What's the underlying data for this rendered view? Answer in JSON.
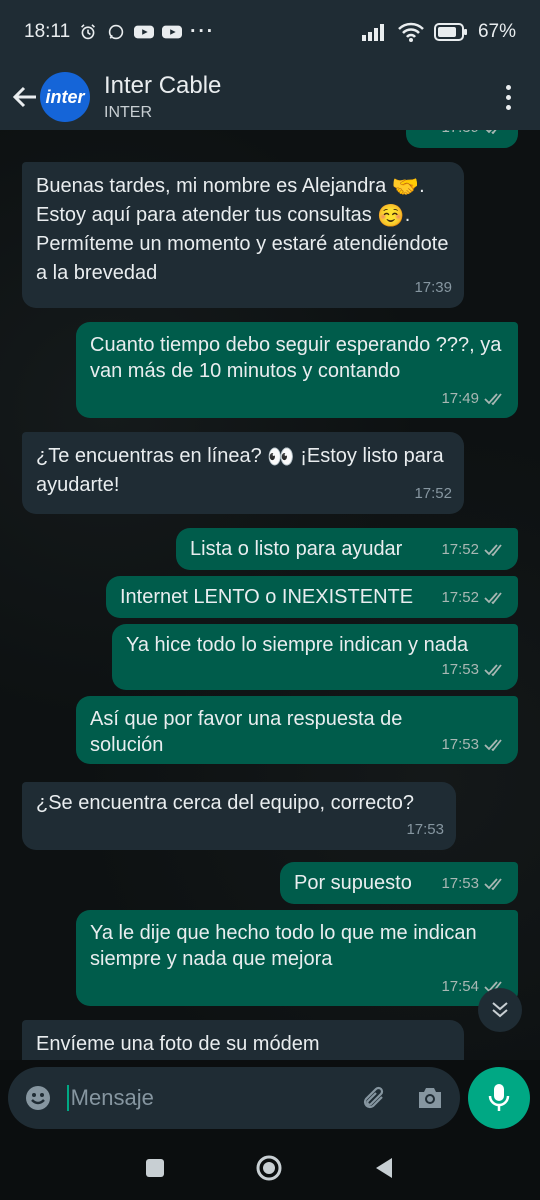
{
  "status_bar": {
    "time": "18:11",
    "battery": "67%",
    "notification_icons": [
      "alarm-icon",
      "whatsapp-icon",
      "youtube-icon",
      "youtube-icon"
    ],
    "more": "···"
  },
  "header": {
    "title": "Inter Cable",
    "subtitle": "INTER",
    "avatar_text": "inter",
    "avatar_color": "#1565d8"
  },
  "messages": [
    {
      "dir": "out",
      "text": "",
      "time": "17:39"
    },
    {
      "dir": "in",
      "text_parts": [
        "Buenas tardes, mi nombre es Alejandra ",
        "🤝",
        ".  Estoy aquí para atender tus consultas ",
        "☺️",
        ". Permíteme un momento y estaré atendiéndote a la brevedad"
      ],
      "time": "17:39"
    },
    {
      "dir": "out",
      "text": "Cuanto tiempo debo seguir esperando ???, ya van más de 10 minutos y contando",
      "time": "17:49"
    },
    {
      "dir": "in",
      "text_parts": [
        "¿Te encuentras en línea? ",
        "👀",
        " ¡Estoy listo para ayudarte!"
      ],
      "time": "17:52"
    },
    {
      "dir": "out",
      "text": "Lista o listo para ayudar",
      "time": "17:52"
    },
    {
      "dir": "out",
      "text": "Internet LENTO o INEXISTENTE",
      "time": "17:52"
    },
    {
      "dir": "out",
      "text": "Ya hice todo lo siempre indican y nada",
      "time": "17:53"
    },
    {
      "dir": "out",
      "text": "Así que por favor una respuesta de solución",
      "time": "17:53"
    },
    {
      "dir": "in",
      "text": "¿Se encuentra cerca del equipo, correcto?",
      "time": "17:53"
    },
    {
      "dir": "out",
      "text": "Por supuesto",
      "time": "17:53"
    },
    {
      "dir": "out",
      "text": "Ya le dije que hecho todo lo que me indican siempre y nada que mejora",
      "time": "17:54"
    },
    {
      "dir": "in",
      "text": "Envíeme una foto de su módem",
      "time": ""
    }
  ],
  "input": {
    "placeholder": "Mensaje"
  },
  "colors": {
    "bubble_in": "#1f2c34",
    "bubble_out": "#005c4b",
    "accent": "#00a884"
  }
}
